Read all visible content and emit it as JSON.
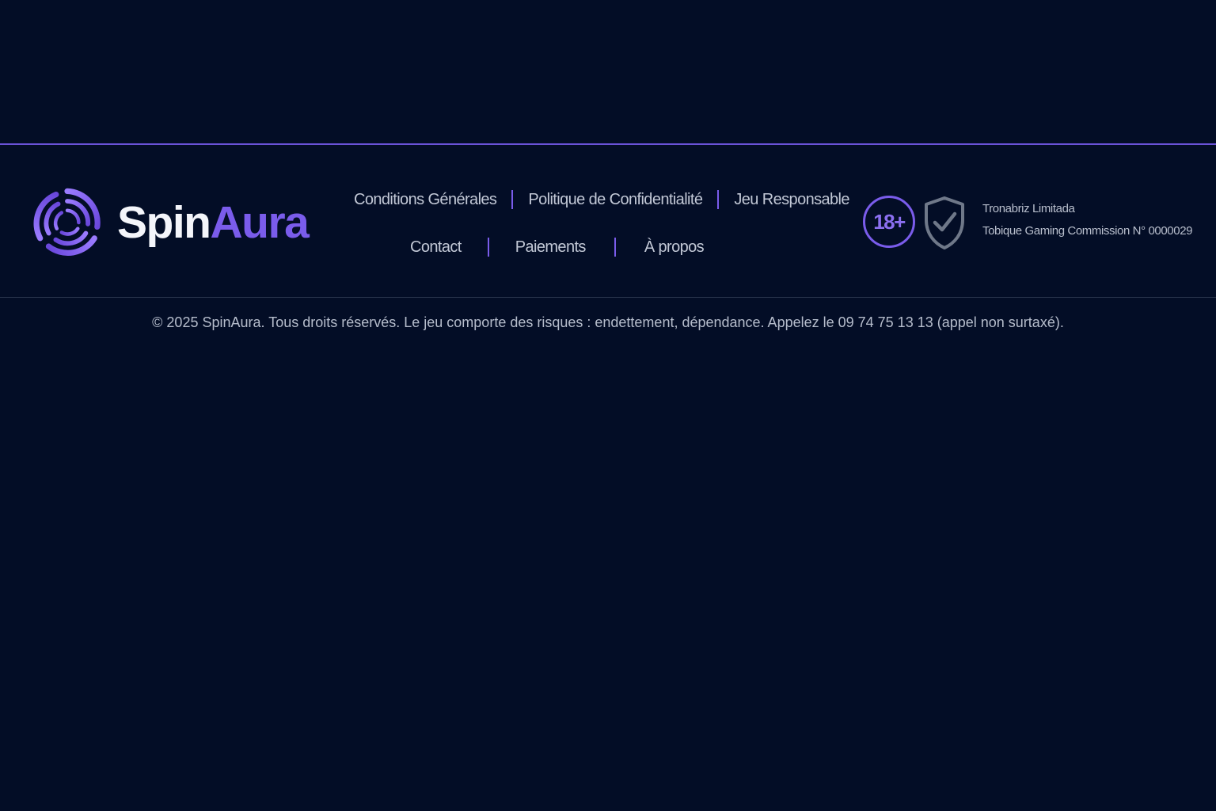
{
  "brand": {
    "name_part1": "Spin",
    "name_part2": "Aura",
    "logo_icon": "spiral-logo-icon",
    "accent_color": "#7a5ceb",
    "background_color": "#030d26"
  },
  "footer": {
    "nav_row_1": [
      {
        "label": "Conditions Générales"
      },
      {
        "label": "Politique de Confidentialité"
      },
      {
        "label": "Jeu Responsable"
      }
    ],
    "nav_row_2": [
      {
        "label": "Contact"
      },
      {
        "label": "Paiements"
      },
      {
        "label": "À propos"
      }
    ],
    "age_badge": "18+",
    "shield_icon": "shield-check-icon",
    "license": {
      "company": "Tronabriz Limitada",
      "commission": "Tobique Gaming Commission N° 0000029"
    },
    "copyright": "© 2025 SpinAura. Tous droits réservés. Le jeu comporte des risques : endettement, dépendance. Appelez le 09 74 75 13 13 (appel non surtaxé)."
  }
}
